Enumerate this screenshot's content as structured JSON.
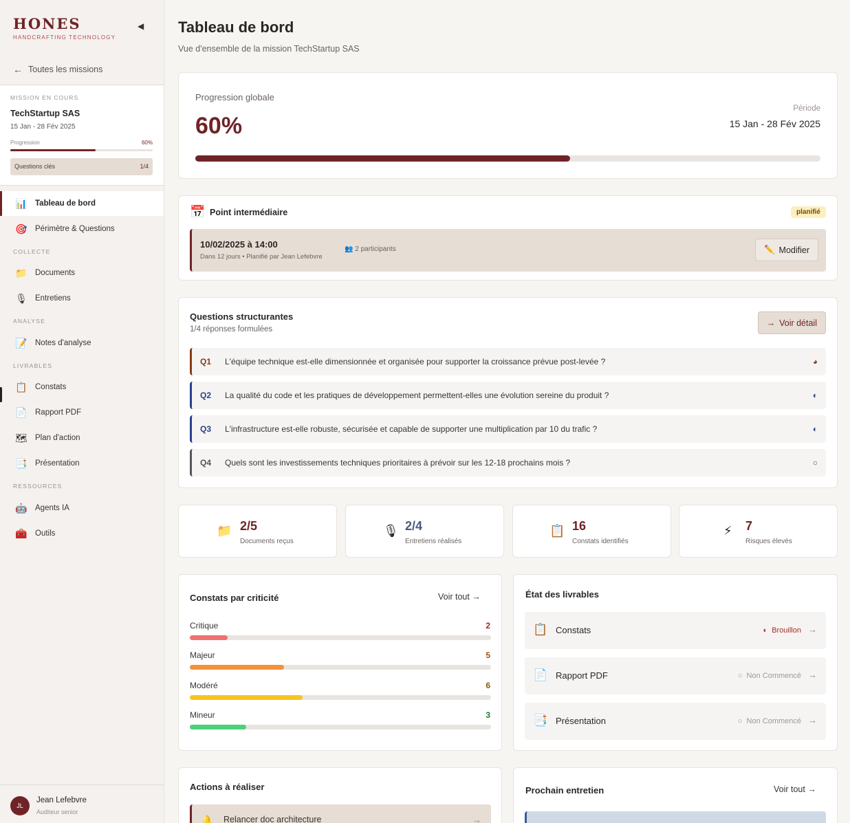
{
  "brand": {
    "name": "HONES",
    "tagline": "HANDCRAFTING TECHNOLOGY",
    "collapse_icon": "◀"
  },
  "sidebar": {
    "back_label": "Toutes les missions",
    "mission": {
      "section_label": "MISSION EN COURS",
      "name": "TechStartup SAS",
      "dates": "15 Jan - 28 Fév 2025",
      "progress_label": "Progression",
      "progress_value": "60%",
      "progress": 0.6,
      "questions_label": "Questions clés",
      "questions_value": "1/4"
    },
    "items": [
      {
        "label": "Tableau de bord",
        "icon": "📊"
      },
      {
        "label": "Périmètre & Questions",
        "icon": "🎯"
      },
      {
        "label": "Documents",
        "icon": "📁"
      },
      {
        "label": "Entretiens",
        "icon": "🎙"
      },
      {
        "label": "Notes d'analyse",
        "icon": "📝"
      },
      {
        "label": "Constats",
        "icon": "📋"
      },
      {
        "label": "Rapport PDF",
        "icon": "📄"
      },
      {
        "label": "Plan d'action",
        "icon": "🗺"
      },
      {
        "label": "Présentation",
        "icon": "📑"
      },
      {
        "label": "Agents IA",
        "icon": "🤖"
      },
      {
        "label": "Outils",
        "icon": "🧰"
      }
    ],
    "sections": [
      "COLLECTE",
      "ANALYSE",
      "LIVRABLES",
      "RESSOURCES"
    ],
    "user": {
      "initials": "JL",
      "name": "Jean Lefebvre",
      "role": "Auditeur senior"
    }
  },
  "header": {
    "title": "Tableau de bord",
    "subtitle": "Vue d'ensemble de la mission TechStartup SAS"
  },
  "progress": {
    "label": "Progression globale",
    "value": "60%",
    "fraction": 0.6,
    "period_label": "Période",
    "period": "15 Jan - 28 Fév 2025"
  },
  "milestone": {
    "icon": "📅",
    "title": "Point intermédiaire",
    "badge": "planifié",
    "datetime": "10/02/2025 à 14:00",
    "meta": "Dans 12 jours • Planifié par Jean Lefebvre",
    "participants": "👥 2 participants",
    "edit_label": "Modifier",
    "edit_icon": "✏️"
  },
  "questions": {
    "title": "Questions structurantes",
    "subtitle": "1/4 réponses formulées",
    "detail_label": "Voir détail",
    "detail_icon": "→",
    "items": [
      {
        "num": "Q1",
        "text": "L'équipe technique est-elle dimensionnée et organisée pour supporter la croissance prévue post-levée ?",
        "status_icon": "◕",
        "color": "#8a3a1a"
      },
      {
        "num": "Q2",
        "text": "La qualité du code et les pratiques de développement permettent-elles une évolution sereine du produit ?",
        "status_icon": "◐",
        "color": "#2a3f8f"
      },
      {
        "num": "Q3",
        "text": "L'infrastructure est-elle robuste, sécurisée et capable de supporter une multiplication par 10 du trafic ?",
        "status_icon": "◐",
        "color": "#2a3f8f"
      },
      {
        "num": "Q4",
        "text": "Quels sont les investissements techniques prioritaires à prévoir sur les 12-18 prochains mois ?",
        "status_icon": "○",
        "color": "#555555"
      }
    ]
  },
  "stats": [
    {
      "icon": "📁",
      "value": "2/5",
      "label": "Documents reçus",
      "color": "#6f2327"
    },
    {
      "icon": "🎙",
      "value": "2/4",
      "label": "Entretiens réalisés",
      "color": "#4a5a80"
    },
    {
      "icon": "📋",
      "value": "16",
      "label": "Constats identifiés",
      "color": "#6f2327"
    },
    {
      "icon": "⚡",
      "value": "7",
      "label": "Risques élevés",
      "color": "#6f2327"
    }
  ],
  "criticality": {
    "title": "Constats par criticité",
    "see_all": "Voir tout →",
    "max": 16,
    "items": [
      {
        "label": "Critique",
        "value": 2,
        "color": "#f07070",
        "val_color": "#b02020",
        "fraction": 0.125
      },
      {
        "label": "Majeur",
        "value": 5,
        "color": "#f5913a",
        "val_color": "#a05010",
        "fraction": 0.3125
      },
      {
        "label": "Modéré",
        "value": 6,
        "color": "#f7c51e",
        "val_color": "#8a5a00",
        "fraction": 0.375
      },
      {
        "label": "Mineur",
        "value": 3,
        "color": "#4cd07a",
        "val_color": "#1e7a3a",
        "fraction": 0.1875
      }
    ]
  },
  "deliverables": {
    "title": "État des livrables",
    "items": [
      {
        "icon": "📋",
        "name": "Constats",
        "status_icon": "◐",
        "status": "Brouillon",
        "color": "#a03028"
      },
      {
        "icon": "📄",
        "name": "Rapport PDF",
        "status_icon": "○",
        "status": "Non Commencé",
        "color": "#999999"
      },
      {
        "icon": "📑",
        "name": "Présentation",
        "status_icon": "○",
        "status": "Non Commencé",
        "color": "#999999"
      }
    ],
    "arrow": "→"
  },
  "actions": {
    "title": "Actions à réaliser",
    "first_icon": "🔔",
    "first_text": "Relancer doc architecture",
    "arrow": "→"
  },
  "next_interview": {
    "title": "Prochain entretien",
    "see_all": "Voir tout →"
  }
}
